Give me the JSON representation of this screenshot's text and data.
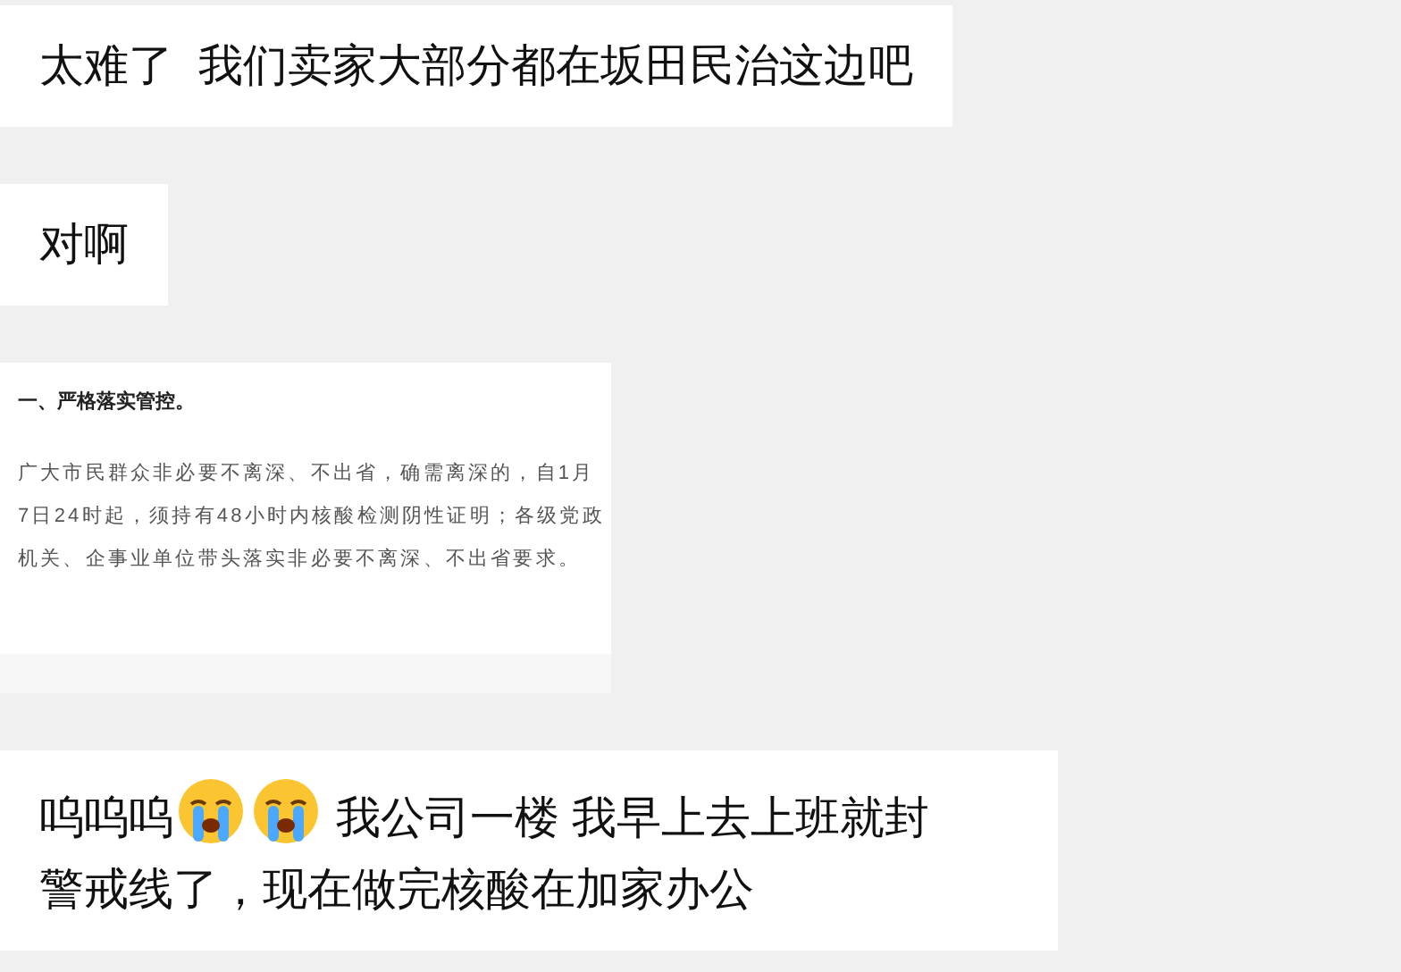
{
  "messages": [
    {
      "kind": "text",
      "parts": [
        {
          "kind": "text",
          "text": "太难了  我们卖家大部分都在坂田民治这边吧"
        }
      ]
    },
    {
      "kind": "text",
      "parts": [
        {
          "kind": "text",
          "text": "对啊"
        }
      ]
    },
    {
      "kind": "image",
      "heading": "一、严格落实管控。",
      "body": "广大市民群众非必要不离深、不出省，确需离深的，自1月7日24时起，须持有48小时内核酸检测阴性证明；各级党政机关、企事业单位带头落实非必要不离深、不出省要求。"
    },
    {
      "kind": "text",
      "parts": [
        {
          "kind": "text",
          "text": "呜呜呜"
        },
        {
          "kind": "emoji"
        },
        {
          "kind": "emoji"
        },
        {
          "kind": "text",
          "text": " 我公司一楼 我早上去上班就封"
        },
        {
          "kind": "text",
          "text": "警戒线了，现在做完核酸在加家办公"
        }
      ]
    }
  ]
}
